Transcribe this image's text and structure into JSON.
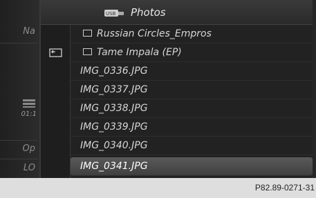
{
  "header": {
    "title": "Photos",
    "source_icon": "usb-icon"
  },
  "left": {
    "item1": "Na",
    "time": "01:1",
    "item2": "Op",
    "item3": "LO"
  },
  "list": {
    "items": [
      {
        "label": "Russian Circles_Empros",
        "type": "folder"
      },
      {
        "label": "Tame Impala (EP)",
        "type": "folder"
      },
      {
        "label": "IMG_0336.JPG",
        "type": "file"
      },
      {
        "label": "IMG_0337.JPG",
        "type": "file"
      },
      {
        "label": "IMG_0338.JPG",
        "type": "file"
      },
      {
        "label": "IMG_0339.JPG",
        "type": "file"
      },
      {
        "label": "IMG_0340.JPG",
        "type": "file"
      },
      {
        "label": "IMG_0341.JPG",
        "type": "file",
        "selected": true
      }
    ]
  },
  "footer": {
    "code": "P82.89-0271-31"
  }
}
